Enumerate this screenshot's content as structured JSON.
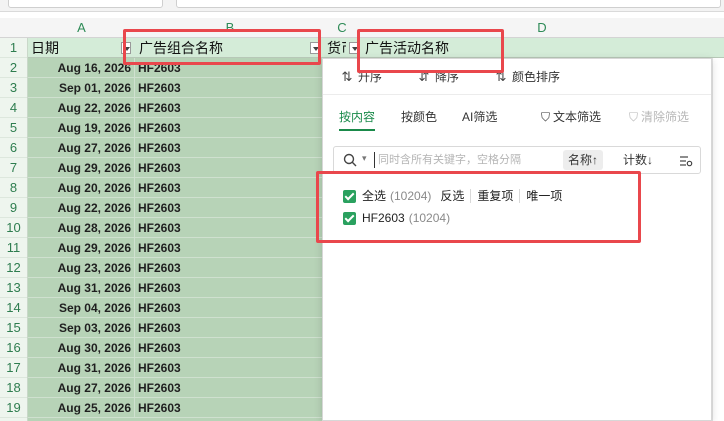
{
  "columns": [
    "A",
    "B",
    "C",
    "D"
  ],
  "rows": [
    "1",
    "2",
    "3",
    "4",
    "5",
    "6",
    "7",
    "8",
    "9",
    "10",
    "11",
    "12",
    "13",
    "14",
    "15",
    "16",
    "17",
    "18",
    "19"
  ],
  "header_row": {
    "a": "日期",
    "b": "广告组合名称",
    "c": "货币",
    "d": "广告活动名称"
  },
  "data": [
    {
      "date": "Aug 16, 2026",
      "group": "HF2603"
    },
    {
      "date": "Sep 01, 2026",
      "group": "HF2603"
    },
    {
      "date": "Aug 22, 2026",
      "group": "HF2603"
    },
    {
      "date": "Aug 19, 2026",
      "group": "HF2603"
    },
    {
      "date": "Aug 27, 2026",
      "group": "HF2603"
    },
    {
      "date": "Aug 29, 2026",
      "group": "HF2603"
    },
    {
      "date": "Aug 20, 2026",
      "group": "HF2603"
    },
    {
      "date": "Aug 22, 2026",
      "group": "HF2603"
    },
    {
      "date": "Aug 28, 2026",
      "group": "HF2603"
    },
    {
      "date": "Aug 29, 2026",
      "group": "HF2603"
    },
    {
      "date": "Aug 23, 2026",
      "group": "HF2603"
    },
    {
      "date": "Aug 31, 2026",
      "group": "HF2603"
    },
    {
      "date": "Sep 04, 2026",
      "group": "HF2603"
    },
    {
      "date": "Sep 03, 2026",
      "group": "HF2603"
    },
    {
      "date": "Aug 30, 2026",
      "group": "HF2603"
    },
    {
      "date": "Aug 31, 2026",
      "group": "HF2603"
    },
    {
      "date": "Aug 27, 2026",
      "group": "HF2603"
    },
    {
      "date": "Aug 25, 2026",
      "group": "HF2603"
    }
  ],
  "popup": {
    "sort": {
      "asc": "升序",
      "desc": "降序",
      "color": "颜色排序"
    },
    "tabs": {
      "content": "按内容",
      "color": "按颜色",
      "ai": "AI筛选",
      "text": "文本筛选",
      "clear": "清除筛选"
    },
    "search": {
      "placeholder": "同时含所有关键字，空格分隔",
      "name_sort": "名称↑",
      "count_sort": "计数↓"
    },
    "select_all": {
      "label": "全选",
      "count": "(10204)",
      "invert": "反选",
      "duplicates": "重复项",
      "unique": "唯一项"
    },
    "values": [
      {
        "label": "HF2603",
        "count": "(10204)"
      }
    ]
  },
  "colors": {
    "accent": "#1a8a4a",
    "checkbox": "#2aa15f",
    "annotation": "#e9474c",
    "selection": "#b7d3b7"
  }
}
